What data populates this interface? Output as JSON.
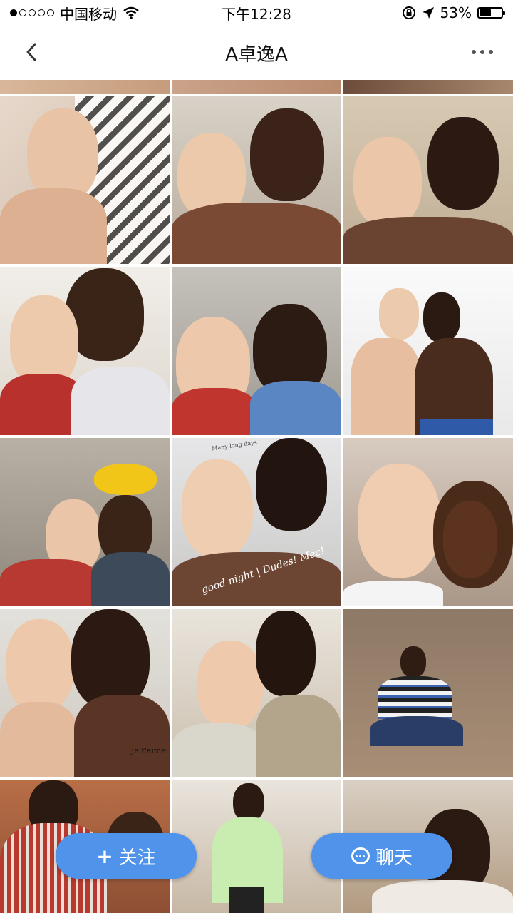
{
  "status_bar": {
    "carrier": "中国移动",
    "time": "下午12:28",
    "battery_percent": "53%",
    "battery_level": 0.53,
    "signal_strength": 1,
    "signal_icon": "signal-dots-icon",
    "wifi_icon": "wifi-icon",
    "lock_icon": "rotation-lock-icon",
    "location_icon": "location-arrow-icon"
  },
  "nav": {
    "title": "A卓逸A",
    "back_icon": "back-chevron-icon",
    "more_icon": "more-dots-icon"
  },
  "photos": {
    "watermarks": [
      "good night | Dudes! Mec!",
      "Je t'aime",
      "Many long days"
    ]
  },
  "actions": {
    "follow_label": "关注",
    "follow_icon": "plus-icon",
    "chat_label": "聊天",
    "chat_icon": "chat-bubble-icon",
    "accent_color": "#4f93ea"
  }
}
